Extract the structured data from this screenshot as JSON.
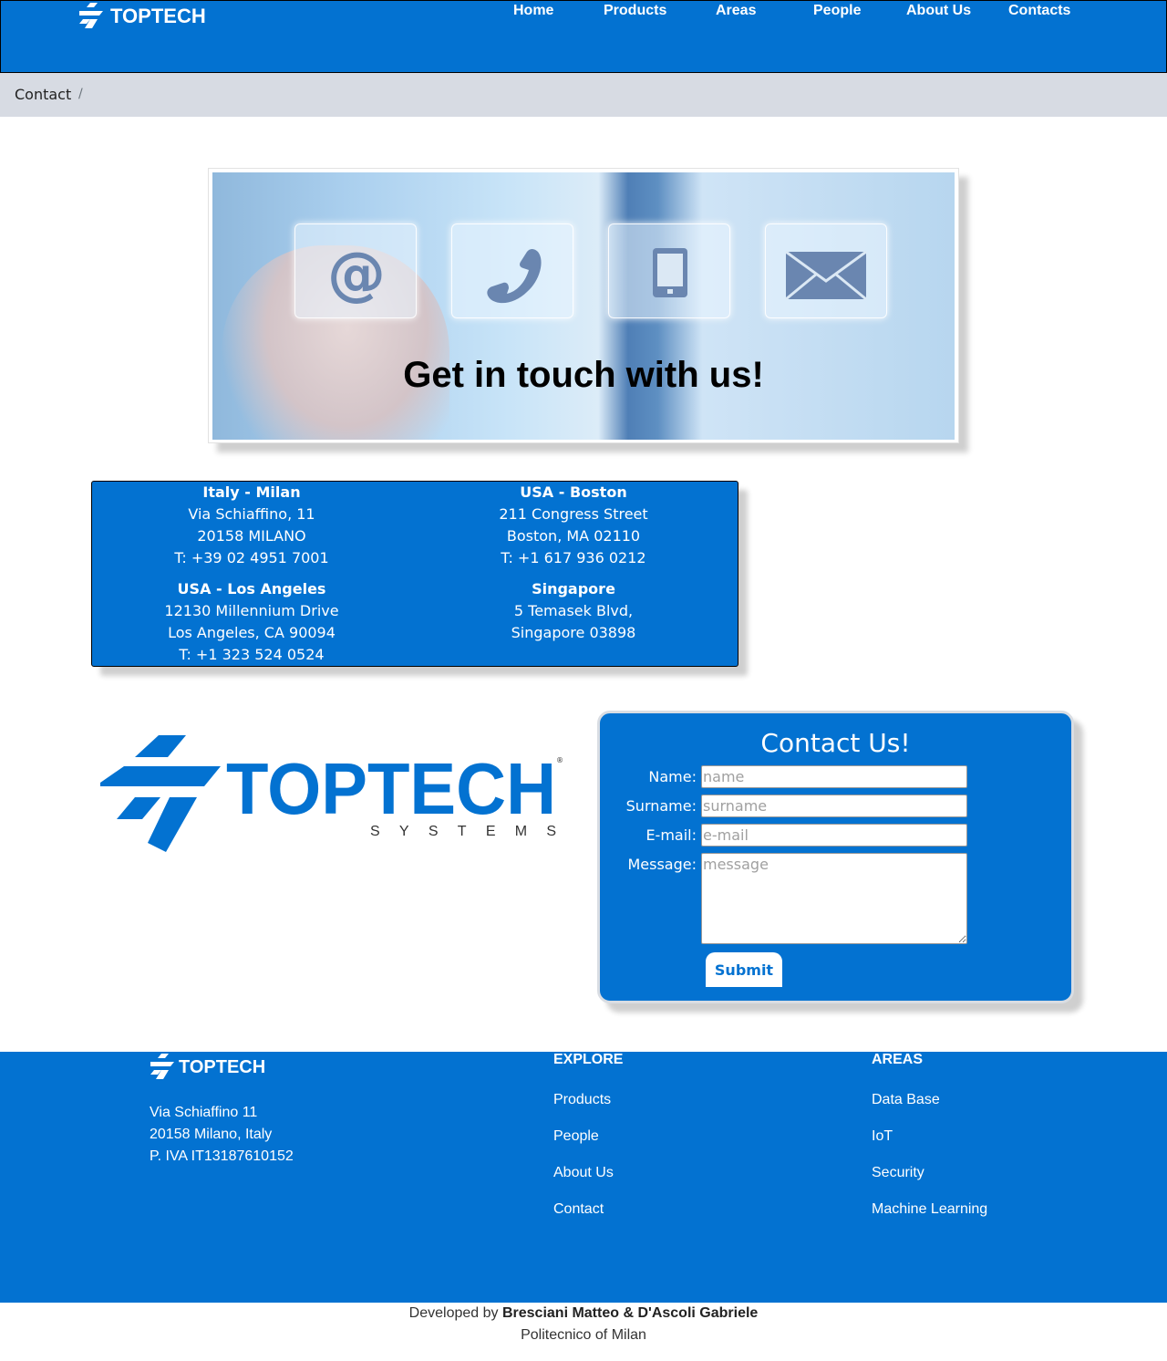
{
  "nav": {
    "brand": "TOPTECH",
    "links": [
      "Home",
      "Products",
      "Areas",
      "People",
      "About Us",
      "Contacts"
    ]
  },
  "breadcrumb": {
    "current": "Contact",
    "separator": "/"
  },
  "hero": {
    "caption": "Get in touch with us!",
    "icons": [
      "at-sign-icon",
      "phone-icon",
      "mobile-icon",
      "envelope-icon"
    ]
  },
  "offices": [
    {
      "name": "Italy - Milan",
      "lines": [
        "Via Schiaffino, 11",
        "20158 MILANO",
        "T: +39 02 4951 7001"
      ]
    },
    {
      "name": "USA - Boston",
      "lines": [
        "211 Congress Street",
        "Boston, MA 02110",
        "T: +1 617 936 0212"
      ]
    },
    {
      "name": "USA - Los Angeles",
      "lines": [
        "12130 Millennium Drive",
        "Los Angeles, CA 90094",
        "T: +1 323 524 0524"
      ]
    },
    {
      "name": "Singapore",
      "lines": [
        "5 Temasek Blvd,",
        "Singapore 03898"
      ]
    }
  ],
  "big_logo": {
    "wordmark": "TOPTECH",
    "tagline": "SYSTEMS",
    "mark": "®"
  },
  "form": {
    "title": "Contact Us!",
    "fields": [
      {
        "label": "Name:",
        "placeholder": "name",
        "value": ""
      },
      {
        "label": "Surname:",
        "placeholder": "surname",
        "value": ""
      },
      {
        "label": "E-mail:",
        "placeholder": "e-mail",
        "value": ""
      },
      {
        "label": "Message:",
        "placeholder": "message",
        "value": ""
      }
    ],
    "submit_label": "Submit"
  },
  "footer": {
    "brand": "TOPTECH",
    "address": [
      "Via Schiaffino 11",
      "20158 Milano, Italy",
      "P. IVA IT13187610152"
    ],
    "explore": {
      "heading": "EXPLORE",
      "links": [
        "Products",
        "People",
        "About Us",
        "Contact"
      ]
    },
    "areas": {
      "heading": "AREAS",
      "links": [
        "Data Base",
        "IoT",
        "Security",
        "Machine Learning"
      ]
    }
  },
  "credits": {
    "prefix": "Developed by",
    "authors": "Bresciani Matteo & D'Ascoli Gabriele",
    "institution": "Politecnico of Milan"
  },
  "colors": {
    "brand_blue": "#0372d1",
    "breadcrumb_bg": "#d7dbe3",
    "white": "#ffffff"
  }
}
